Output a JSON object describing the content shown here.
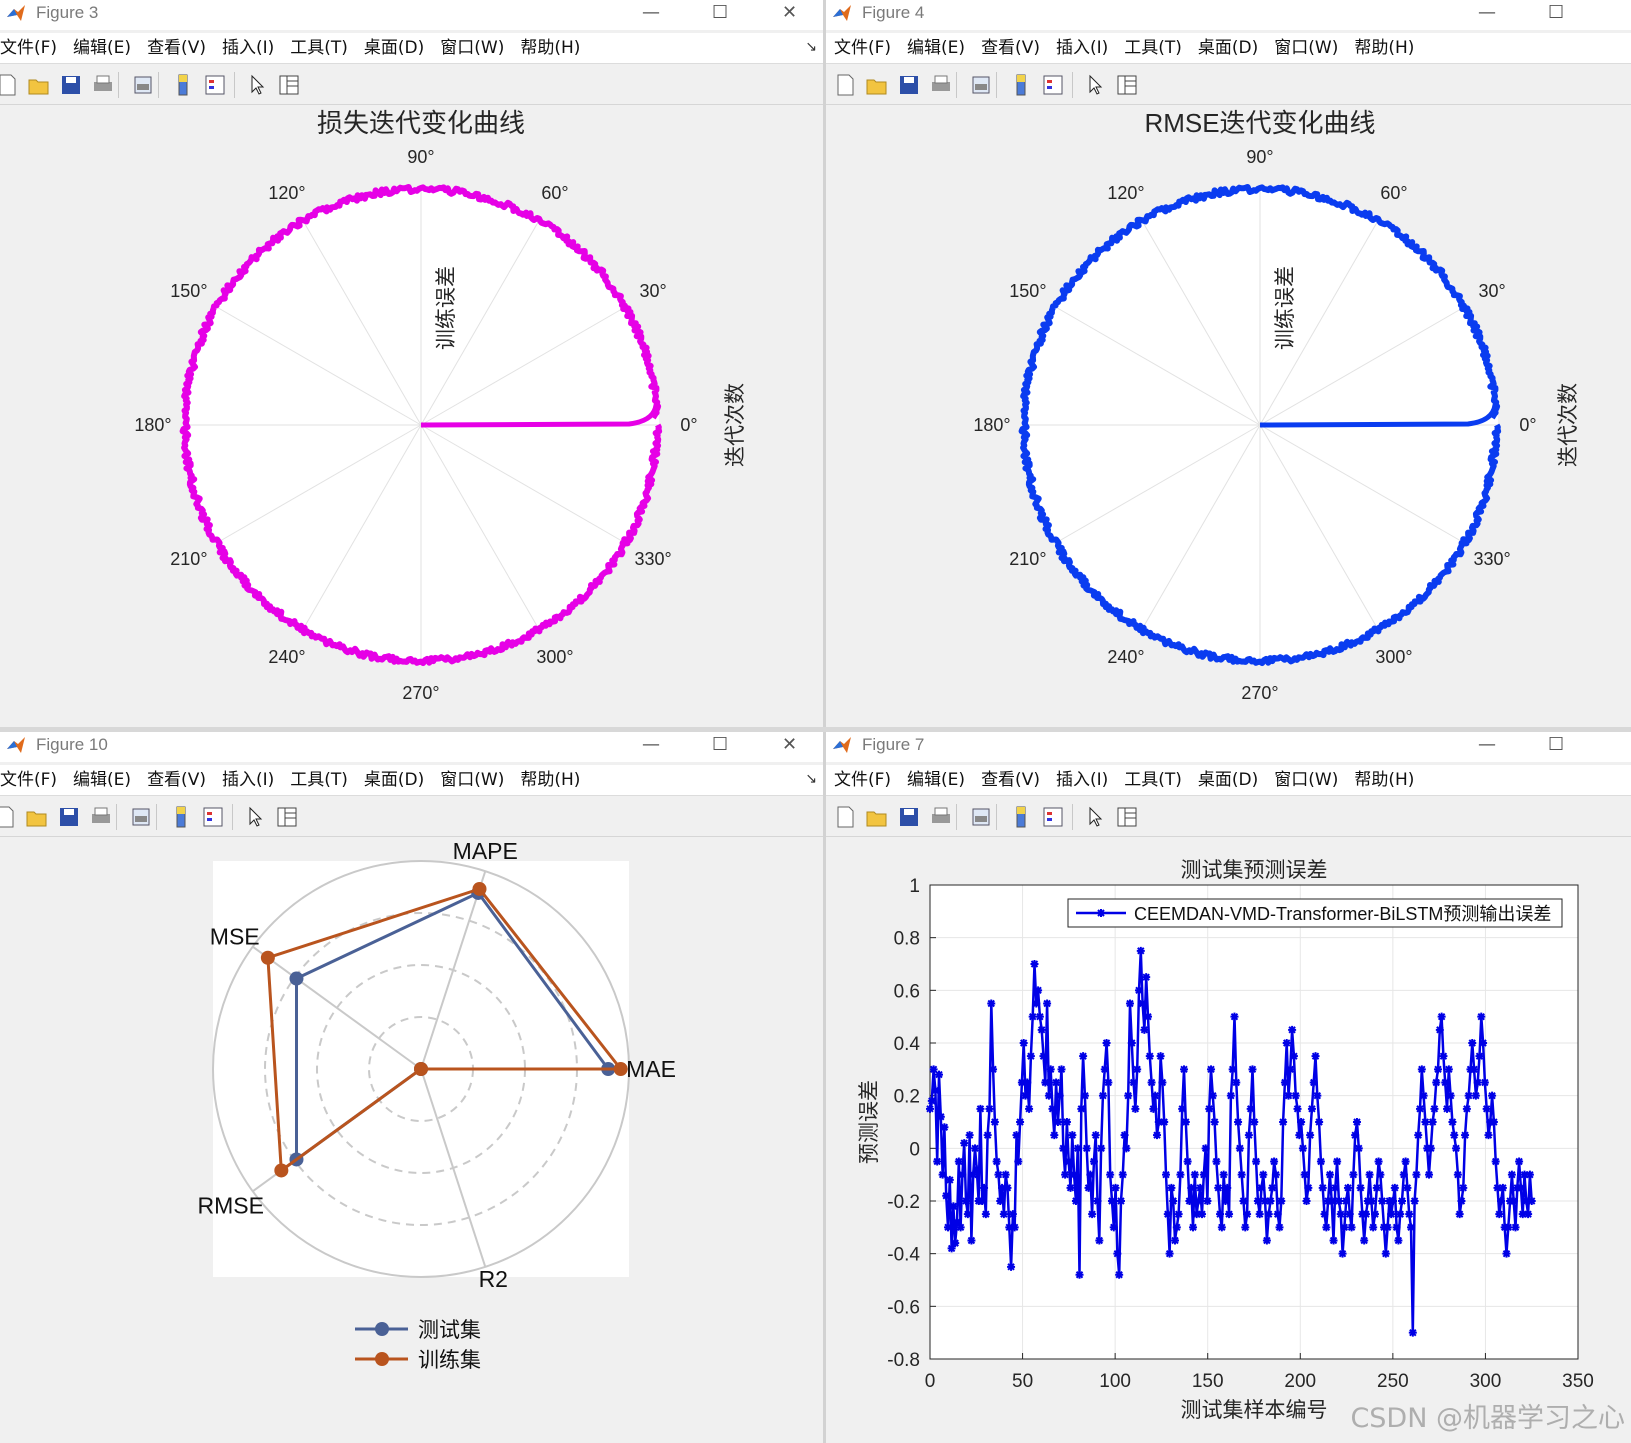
{
  "menus": [
    "文件(F)",
    "编辑(E)",
    "查看(V)",
    "插入(I)",
    "工具(T)",
    "桌面(D)",
    "窗口(W)",
    "帮助(H)"
  ],
  "toolbar_icons": [
    "new-figure-icon",
    "open-file-icon",
    "save-icon",
    "print-icon",
    "print-preview-icon",
    "colorbar-icon",
    "legend-icon",
    "edit-plot-arrow-icon",
    "property-inspector-icon"
  ],
  "win_controls": {
    "minimize": "—",
    "maximize": "☐",
    "close": "✕"
  },
  "fig3": {
    "title": "Figure 3",
    "plot_title": "损失迭代变化曲线",
    "r_label": "训练误差",
    "theta_label": "迭代次数",
    "line_color": "#e600e6",
    "angle_labels": [
      "0°",
      "30°",
      "60°",
      "90°",
      "120°",
      "150°",
      "180°",
      "210°",
      "240°",
      "270°",
      "300°",
      "330°"
    ]
  },
  "fig4": {
    "title": "Figure 4",
    "plot_title": "RMSE迭代变化曲线",
    "r_label": "训练误差",
    "theta_label": "迭代次数",
    "line_color": "#0a3cf0",
    "angle_labels": [
      "0°",
      "30°",
      "60°",
      "90°",
      "120°",
      "150°",
      "180°",
      "210°",
      "240°",
      "270°",
      "300°",
      "330°"
    ]
  },
  "fig10": {
    "title": "Figure 10",
    "axes": [
      "MAE",
      "MAPE",
      "MSE",
      "RMSE",
      "R2"
    ],
    "legend": [
      "测试集",
      "训练集"
    ],
    "colors": [
      "#4a6196",
      "#b9541e"
    ],
    "chart_data": {
      "type": "radar",
      "categories": [
        "MAE",
        "MAPE",
        "MSE",
        "RMSE",
        "R2"
      ],
      "rlim": [
        0,
        1
      ],
      "series": [
        {
          "name": "测试集",
          "values": [
            0.9,
            0.89,
            0.74,
            0.74,
            0.0
          ]
        },
        {
          "name": "训练集",
          "values": [
            0.96,
            0.91,
            0.91,
            0.83,
            0.0
          ]
        }
      ]
    }
  },
  "fig7": {
    "title": "Figure 7",
    "chart_data": {
      "type": "line",
      "title": "测试集预测误差",
      "xlabel": "测试集样本编号",
      "ylabel": "预测误差",
      "xlim": [
        0,
        350
      ],
      "ylim": [
        -0.8,
        1
      ],
      "xticks": [
        0,
        50,
        100,
        150,
        200,
        250,
        300,
        350
      ],
      "yticks": [
        -0.8,
        -0.6,
        -0.4,
        -0.2,
        0,
        0.2,
        0.4,
        0.6,
        0.8,
        1
      ],
      "grid": true,
      "legend_position": "top-right",
      "series": [
        {
          "name": "CEEMDAN-VMD-Transformer-BiLSTM预测输出误差",
          "color": "#0000e6",
          "values": [
            0.15,
            0.18,
            0.3,
            0.22,
            -0.05,
            0.28,
            0.12,
            -0.1,
            0.08,
            -0.18,
            -0.3,
            -0.12,
            -0.38,
            -0.22,
            -0.36,
            -0.28,
            -0.05,
            -0.3,
            -0.1,
            0.02,
            -0.2,
            -0.25,
            0.05,
            -0.35,
            -0.1,
            0.0,
            -0.08,
            -0.2,
            0.15,
            -0.2,
            -0.15,
            -0.25,
            0.05,
            0.15,
            0.55,
            0.3,
            0.1,
            -0.05,
            -0.1,
            -0.2,
            -0.15,
            -0.25,
            -0.1,
            -0.15,
            -0.3,
            -0.45,
            -0.25,
            -0.3,
            0.05,
            -0.05,
            0.1,
            0.25,
            0.4,
            0.2,
            0.25,
            0.15,
            0.35,
            0.5,
            0.7,
            0.55,
            0.6,
            0.5,
            0.45,
            0.35,
            0.25,
            0.55,
            0.2,
            0.3,
            0.15,
            0.05,
            0.25,
            0.1,
            0.2,
            0.3,
            0.0,
            -0.1,
            0.1,
            -0.05,
            -0.15,
            0.05,
            -0.1,
            -0.2,
            0.0,
            -0.48,
            0.15,
            0.35,
            0.2,
            0.0,
            -0.15,
            -0.1,
            -0.25,
            -0.05,
            0.05,
            -0.2,
            -0.35,
            0.0,
            0.2,
            0.3,
            0.4,
            0.25,
            -0.1,
            -0.2,
            -0.3,
            -0.15,
            -0.4,
            -0.48,
            -0.2,
            -0.1,
            0.05,
            0.0,
            0.2,
            0.55,
            0.4,
            0.25,
            0.15,
            0.3,
            0.6,
            0.75,
            0.55,
            0.45,
            0.65,
            0.5,
            0.35,
            0.25,
            0.15,
            0.2,
            0.05,
            0.1,
            0.35,
            0.25,
            0.1,
            -0.1,
            -0.25,
            -0.4,
            -0.15,
            -0.2,
            -0.35,
            -0.3,
            -0.25,
            -0.1,
            0.15,
            0.3,
            0.1,
            -0.05,
            -0.2,
            -0.15,
            -0.3,
            -0.1,
            -0.25,
            -0.2,
            -0.15,
            -0.25,
            -0.1,
            0.0,
            -0.2,
            0.15,
            0.3,
            0.2,
            0.1,
            -0.05,
            -0.15,
            -0.25,
            -0.3,
            -0.1,
            -0.2,
            -0.15,
            -0.25,
            0.2,
            0.3,
            0.5,
            0.25,
            0.1,
            0.0,
            -0.1,
            -0.2,
            -0.3,
            -0.25,
            0.05,
            0.15,
            0.3,
            0.1,
            -0.05,
            -0.2,
            -0.25,
            -0.15,
            -0.1,
            -0.2,
            -0.35,
            -0.25,
            -0.2,
            -0.15,
            -0.05,
            -0.1,
            -0.25,
            -0.3,
            -0.2,
            0.1,
            0.25,
            0.4,
            0.2,
            0.3,
            0.45,
            0.35,
            0.2,
            0.15,
            0.05,
            0.1,
            0.0,
            -0.1,
            -0.2,
            -0.15,
            0.05,
            0.15,
            0.25,
            0.35,
            0.2,
            0.1,
            -0.05,
            -0.15,
            -0.25,
            -0.3,
            -0.2,
            -0.1,
            -0.2,
            -0.35,
            -0.15,
            -0.05,
            -0.2,
            -0.25,
            -0.4,
            -0.3,
            -0.2,
            -0.15,
            -0.25,
            -0.3,
            -0.1,
            0.05,
            0.1,
            0.0,
            -0.15,
            -0.25,
            -0.35,
            -0.25,
            -0.2,
            -0.1,
            -0.2,
            -0.3,
            -0.25,
            -0.15,
            -0.05,
            -0.1,
            -0.2,
            -0.3,
            -0.4,
            -0.3,
            -0.2,
            -0.25,
            -0.2,
            -0.15,
            -0.3,
            -0.35,
            -0.25,
            -0.2,
            -0.1,
            -0.05,
            -0.15,
            -0.25,
            -0.3,
            -0.7,
            -0.2,
            -0.1,
            0.05,
            0.15,
            0.3,
            0.2,
            0.1,
            0.0,
            -0.1,
            0.0,
            0.1,
            0.15,
            0.25,
            0.3,
            0.45,
            0.5,
            0.35,
            0.25,
            0.15,
            0.3,
            0.2,
            0.1,
            0.05,
            0.0,
            -0.1,
            -0.25,
            -0.2,
            -0.15,
            0.05,
            0.15,
            0.2,
            0.3,
            0.4,
            0.3,
            0.2,
            0.25,
            0.35,
            0.5,
            0.4,
            0.25,
            0.15,
            0.05,
            0.1,
            0.2,
            0.1,
            -0.05,
            -0.15,
            -0.25,
            -0.2,
            -0.15,
            -0.3,
            -0.4,
            -0.3,
            -0.2,
            -0.1,
            -0.2,
            -0.3,
            -0.15,
            -0.05,
            -0.15,
            -0.25,
            -0.1,
            -0.2,
            -0.25,
            -0.1,
            -0.2
          ]
        }
      ]
    }
  },
  "watermark": "CSDN @机器学习之心"
}
